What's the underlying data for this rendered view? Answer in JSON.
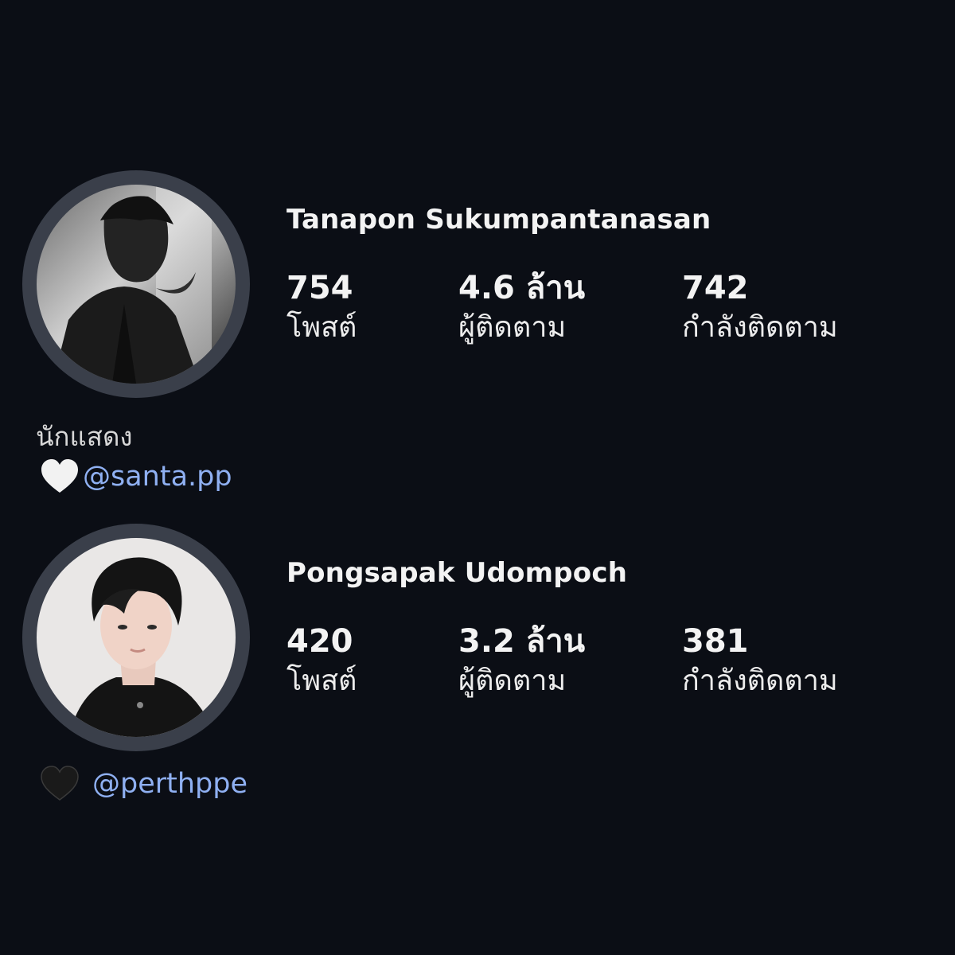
{
  "profiles": [
    {
      "name": "Tanapon Sukumpantanasan",
      "stats": [
        {
          "value": "754",
          "label": "โพสต์"
        },
        {
          "value": "4.6 ล้าน",
          "label": "ผู้ติดตาม"
        },
        {
          "value": "742",
          "label": "กำลังติดตาม"
        }
      ],
      "bio": "นักแสดง",
      "heart_icon": "white-heart-icon",
      "heart_color": "#f2f2f2",
      "handle": "@santa.pp"
    },
    {
      "name": "Pongsapak Udompoch",
      "stats": [
        {
          "value": "420",
          "label": "โพสต์"
        },
        {
          "value": "3.2 ล้าน",
          "label": "ผู้ติดตาม"
        },
        {
          "value": "381",
          "label": "กำลังติดตาม"
        }
      ],
      "heart_icon": "black-heart-icon",
      "heart_color": "#1a1a1a",
      "handle": "@perthppe"
    }
  ],
  "colors": {
    "background": "#0b0e15",
    "ring": "#3a3f4a",
    "link": "#8fb0f2"
  }
}
